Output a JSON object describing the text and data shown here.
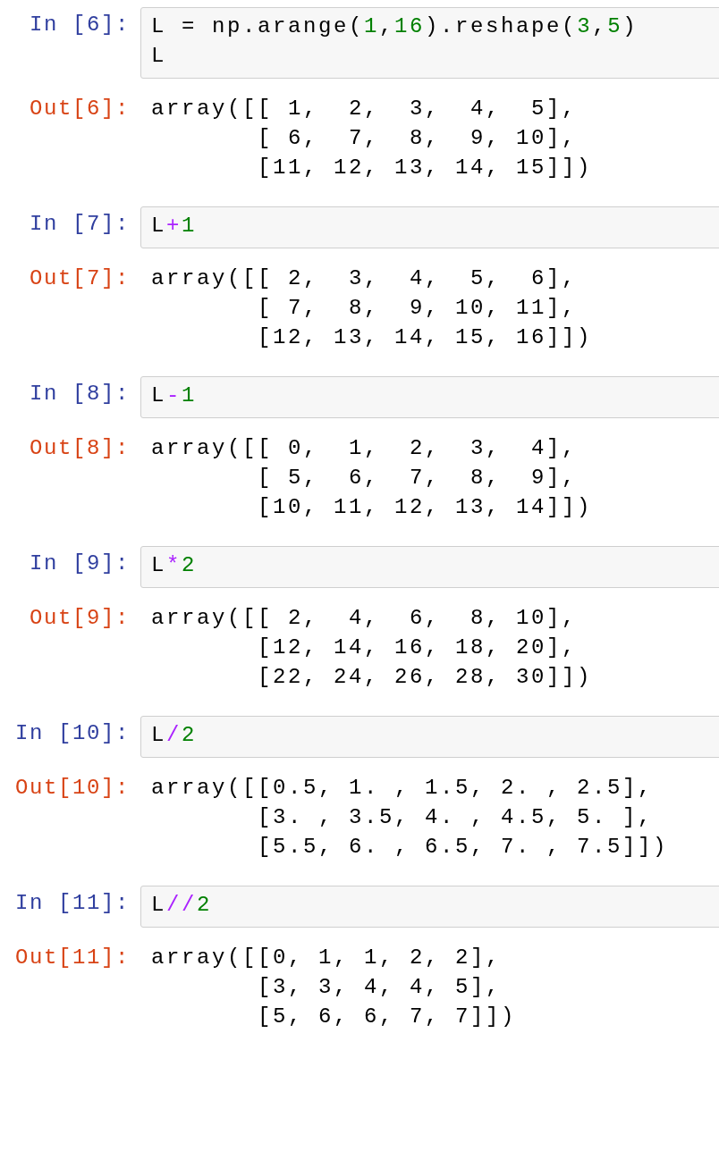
{
  "cells": [
    {
      "in_prompt": "In [6]:",
      "code": [
        [
          {
            "t": "L = np.arange(",
            "kind": "plain"
          },
          {
            "t": "1",
            "kind": "number"
          },
          {
            "t": ",",
            "kind": "plain"
          },
          {
            "t": "16",
            "kind": "number"
          },
          {
            "t": ").reshape(",
            "kind": "plain"
          },
          {
            "t": "3",
            "kind": "number"
          },
          {
            "t": ",",
            "kind": "plain"
          },
          {
            "t": "5",
            "kind": "number"
          },
          {
            "t": ")",
            "kind": "plain"
          }
        ],
        [
          {
            "t": "L",
            "kind": "plain"
          }
        ]
      ],
      "out_prompt": "Out[6]:",
      "output": [
        "array([[ 1,  2,  3,  4,  5],",
        "       [ 6,  7,  8,  9, 10],",
        "       [11, 12, 13, 14, 15]])"
      ]
    },
    {
      "in_prompt": "In [7]:",
      "code": [
        [
          {
            "t": "L",
            "kind": "plain"
          },
          {
            "t": "+",
            "kind": "operator"
          },
          {
            "t": "1",
            "kind": "number"
          }
        ]
      ],
      "out_prompt": "Out[7]:",
      "output": [
        "array([[ 2,  3,  4,  5,  6],",
        "       [ 7,  8,  9, 10, 11],",
        "       [12, 13, 14, 15, 16]])"
      ]
    },
    {
      "in_prompt": "In [8]:",
      "code": [
        [
          {
            "t": "L",
            "kind": "plain"
          },
          {
            "t": "-",
            "kind": "operator"
          },
          {
            "t": "1",
            "kind": "number"
          }
        ]
      ],
      "out_prompt": "Out[8]:",
      "output": [
        "array([[ 0,  1,  2,  3,  4],",
        "       [ 5,  6,  7,  8,  9],",
        "       [10, 11, 12, 13, 14]])"
      ]
    },
    {
      "in_prompt": "In [9]:",
      "code": [
        [
          {
            "t": "L",
            "kind": "plain"
          },
          {
            "t": "*",
            "kind": "operator"
          },
          {
            "t": "2",
            "kind": "number"
          }
        ]
      ],
      "out_prompt": "Out[9]:",
      "output": [
        "array([[ 2,  4,  6,  8, 10],",
        "       [12, 14, 16, 18, 20],",
        "       [22, 24, 26, 28, 30]])"
      ]
    },
    {
      "in_prompt": "In [10]:",
      "code": [
        [
          {
            "t": "L",
            "kind": "plain"
          },
          {
            "t": "/",
            "kind": "operator"
          },
          {
            "t": "2",
            "kind": "number"
          }
        ]
      ],
      "out_prompt": "Out[10]:",
      "output": [
        "array([[0.5, 1. , 1.5, 2. , 2.5],",
        "       [3. , 3.5, 4. , 4.5, 5. ],",
        "       [5.5, 6. , 6.5, 7. , 7.5]])"
      ]
    },
    {
      "in_prompt": "In [11]:",
      "code": [
        [
          {
            "t": "L",
            "kind": "plain"
          },
          {
            "t": "//",
            "kind": "operator"
          },
          {
            "t": "2",
            "kind": "number"
          }
        ]
      ],
      "out_prompt": "Out[11]:",
      "output": [
        "array([[0, 1, 1, 2, 2],",
        "       [3, 3, 4, 4, 5],",
        "       [5, 6, 6, 7, 7]])"
      ]
    }
  ]
}
